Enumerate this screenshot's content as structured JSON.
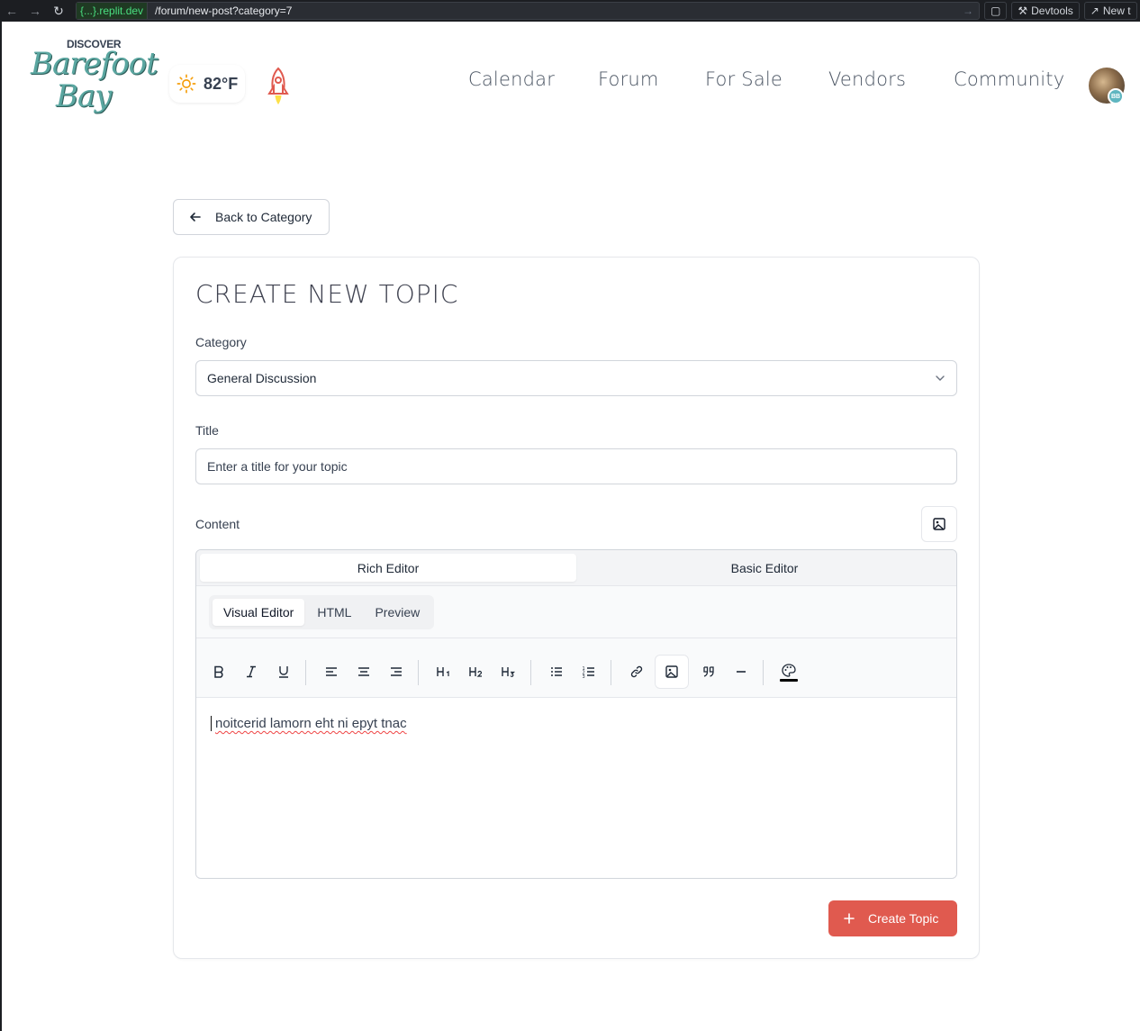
{
  "browser": {
    "domain": "{...}.replit.dev",
    "path": "/forum/new-post?category=7",
    "devtools_label": "Devtools",
    "newtab_label": "New t"
  },
  "header": {
    "logo": {
      "top": "DISCOVER",
      "line1": "Barefoot",
      "line2": "Bay"
    },
    "weather": {
      "temp": "82°F",
      "icon": "sun-icon"
    },
    "nav": [
      "Calendar",
      "Forum",
      "For Sale",
      "Vendors",
      "Community"
    ],
    "avatar_badge": "BB"
  },
  "back_label": "Back to Category",
  "form": {
    "heading": "CREATE NEW TOPIC",
    "category_label": "Category",
    "category_value": "General Discussion",
    "title_label": "Title",
    "title_placeholder": "Enter a title for your topic",
    "content_label": "Content",
    "editor_modes": [
      "Rich Editor",
      "Basic Editor"
    ],
    "view_tabs": [
      "Visual Editor",
      "HTML",
      "Preview"
    ],
    "toolbar_icons": [
      "bold-icon",
      "italic-icon",
      "underline-icon",
      "align-left-icon",
      "align-center-icon",
      "align-right-icon",
      "heading1-icon",
      "heading2-icon",
      "heading3-icon",
      "bullet-list-icon",
      "numbered-list-icon",
      "link-icon",
      "image-icon",
      "quote-icon",
      "horizontal-rule-icon",
      "palette-icon"
    ],
    "content_text": "noitcerid lamorn eht ni epyt tnac",
    "submit_label": "Create Topic"
  },
  "colors": {
    "accent": "#e05a4f",
    "logo": "#5aa6a0"
  }
}
